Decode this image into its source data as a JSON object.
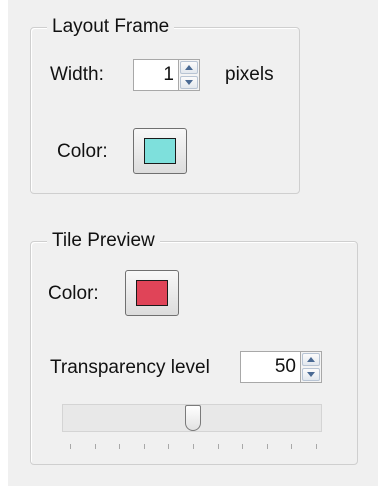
{
  "layout_frame": {
    "title": "Layout Frame",
    "width_label": "Width:",
    "width_value": "1",
    "width_unit": "pixels",
    "color_label": "Color:",
    "color_value": "#7ee0dc"
  },
  "tile_preview": {
    "title": "Tile Preview",
    "color_label": "Color:",
    "color_value": "#e04458",
    "transparency_label": "Transparency level",
    "transparency_value": "50",
    "slider": {
      "min": 0,
      "max": 100,
      "value": 50,
      "tick_count": 11
    }
  }
}
